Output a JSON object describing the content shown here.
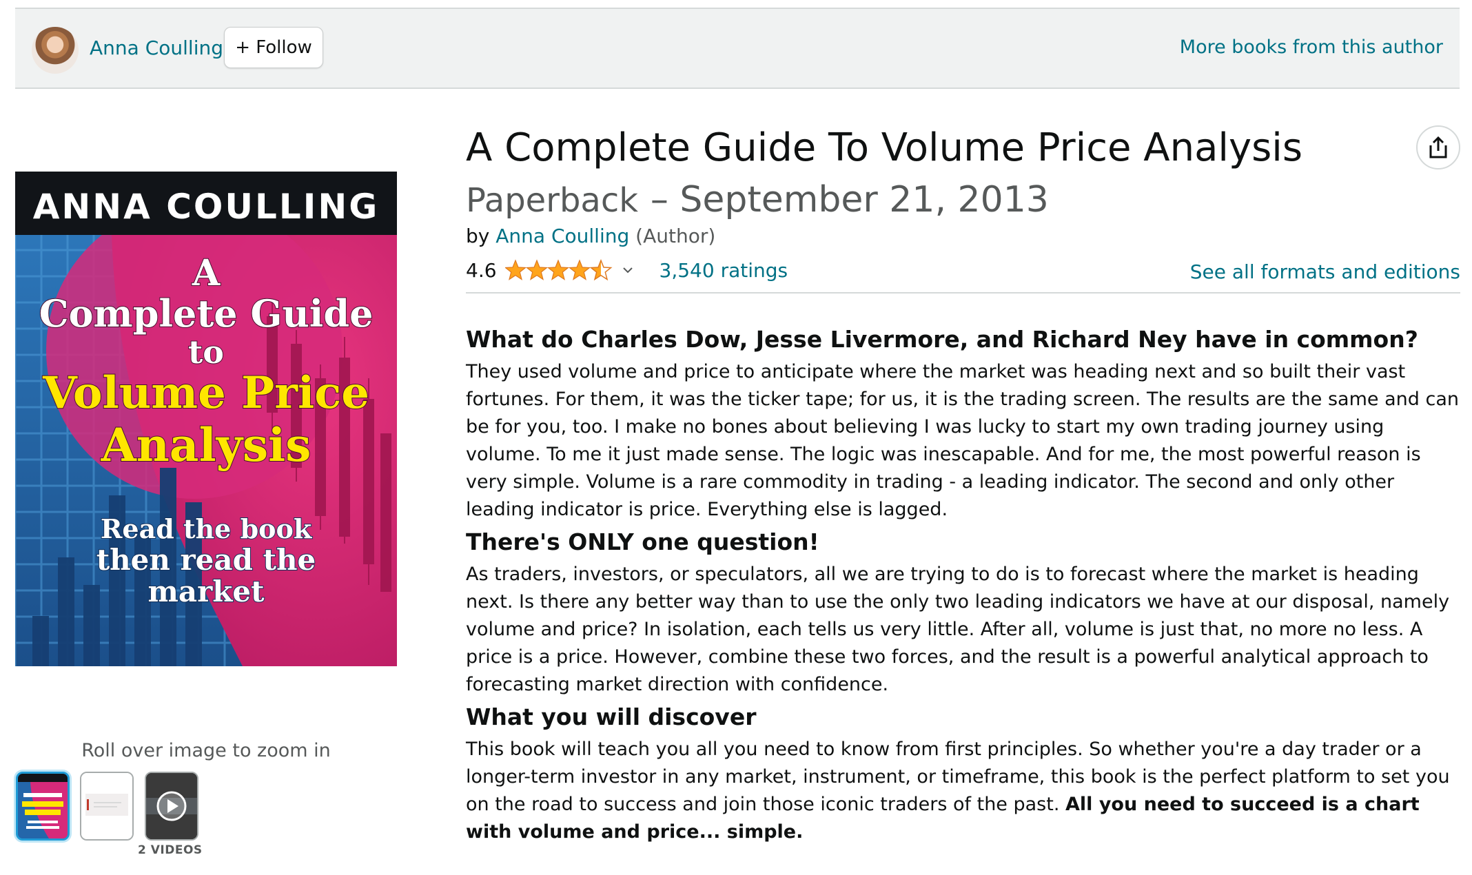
{
  "author_bar": {
    "author_name": "Anna Coulling",
    "follow_label": "+ Follow",
    "more_books_label": "More books from this author"
  },
  "cover": {
    "author": "ANNA COULLING",
    "title_line1": "A",
    "title_line2": "Complete Guide",
    "title_line3": "to",
    "title_line4": "Volume Price",
    "title_line5": "Analysis",
    "tagline_line1": "Read the book",
    "tagline_line2": "then read the",
    "tagline_line3": "market",
    "colors": {
      "top_band": "#111418",
      "magenta": "#d62a7a",
      "blue": "#2466aa",
      "title_white": "#ffffff",
      "title_yellow": "#ffe600"
    }
  },
  "gallery": {
    "zoom_hint": "Roll over image to zoom in",
    "videos_label": "2 VIDEOS",
    "thumbnails": [
      "cover-thumbnail",
      "interior-page-thumbnail",
      "video-thumbnail"
    ]
  },
  "product": {
    "title": "A Complete Guide To Volume Price Analysis",
    "format": "Paperback",
    "date": "– September 21, 2013",
    "by_prefix": "by",
    "author": "Anna Coulling",
    "author_role": "(Author)",
    "rating": "4.6",
    "rating_stars": 4.5,
    "ratings_count": "3,540 ratings",
    "formats_link": "See all formats and editions",
    "accent_color": "#007185",
    "star_color": "#ffa41c"
  },
  "description": {
    "heading1": "What do Charles Dow, Jesse Livermore, and Richard Ney have in common?",
    "para1": "They used volume and price to anticipate where the market was heading next and so built their vast fortunes. For them, it was the ticker tape; for us, it is the trading screen. The results are the same and can be for you, too. I make no bones about believing I was lucky to start my own trading journey using volume. To me it just made sense. The logic was inescapable. And for me, the most powerful reason is very simple. Volume is a rare commodity in trading - a leading indicator. The second and only other leading indicator is price. Everything else is lagged.",
    "heading2": "There's ONLY one question!",
    "para2": "As traders, investors, or speculators, all we are trying to do is to forecast where the market is heading next. Is there any better way than to use the only two leading indicators we have at our disposal, namely volume and price? In isolation, each tells us very little. After all, volume is just that, no more no less. A price is a price. However, combine these two forces, and the result is a powerful analytical approach to forecasting market direction with confidence.",
    "heading3": "What you will discover",
    "para3": "This book will teach you all you need to know from first principles. So whether you're a day trader or a longer-term investor in any market, instrument, or timeframe, this book is the perfect platform to set you on the road to success and join those iconic traders of the past.",
    "para3_bold": "All you need to succeed is a chart with volume and price... simple."
  }
}
